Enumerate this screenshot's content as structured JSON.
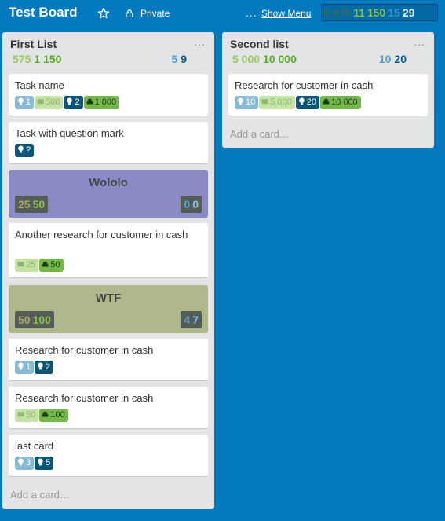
{
  "board": {
    "title": "Test Board",
    "visibility": "Private",
    "menu_dots": "...",
    "show_menu": "Show Menu",
    "stats": [
      "5",
      "575",
      "11",
      "150",
      "15",
      "29"
    ]
  },
  "lists": [
    {
      "title": "First List",
      "menu": "...",
      "stats_left": [
        "575",
        "1 150"
      ],
      "stats_right": [
        "5",
        "9"
      ],
      "add_card": "Add a card…",
      "cards": [
        {
          "title": "Task name",
          "badges": [
            {
              "icon": "lightbulb-icon",
              "value": "1",
              "style": "bd-lb"
            },
            {
              "icon": "book-icon",
              "value": "500",
              "style": "bd-lg"
            },
            {
              "icon": "lightbulb-icon",
              "value": "2",
              "style": "bd-db"
            },
            {
              "icon": "money-icon",
              "value": "1 000",
              "style": "bd-g"
            }
          ]
        },
        {
          "title": "Task with question mark",
          "badges": [
            {
              "icon": "lightbulb-icon",
              "value": "?",
              "style": "bd-db"
            }
          ]
        },
        {
          "separator": true,
          "title": "Wololo",
          "stats_left": [
            "25",
            "50"
          ],
          "stats_right": [
            "0",
            "0"
          ]
        },
        {
          "title": "Another research for customer in cash",
          "badges": [
            {
              "icon": "book-icon",
              "value": "25",
              "style": "bd-lg"
            },
            {
              "icon": "money-icon",
              "value": "50",
              "style": "bd-g"
            }
          ]
        },
        {
          "separator": true,
          "title": "WTF",
          "stats_left": [
            "50",
            "100"
          ],
          "stats_right": [
            "4",
            "7"
          ]
        },
        {
          "title": "Research for customer in cash",
          "badges": [
            {
              "icon": "lightbulb-icon",
              "value": "1",
              "style": "bd-lb"
            },
            {
              "icon": "lightbulb-icon",
              "value": "2",
              "style": "bd-db"
            }
          ]
        },
        {
          "title": "Research for customer in cash",
          "badges": [
            {
              "icon": "book-icon",
              "value": "50",
              "style": "bd-lg"
            },
            {
              "icon": "money-icon",
              "value": "100",
              "style": "bd-g"
            }
          ]
        },
        {
          "title": "last card",
          "badges": [
            {
              "icon": "lightbulb-icon",
              "value": "3",
              "style": "bd-lb"
            },
            {
              "icon": "lightbulb-icon",
              "value": "5",
              "style": "bd-db"
            }
          ]
        }
      ]
    },
    {
      "title": "Second list",
      "menu": "...",
      "stats_left": [
        "5 000",
        "10 000"
      ],
      "stats_right": [
        "10",
        "20"
      ],
      "add_card": "Add a card…",
      "cards": [
        {
          "title": "Research for customer in cash",
          "badges": [
            {
              "icon": "lightbulb-icon",
              "value": "10",
              "style": "bd-lb"
            },
            {
              "icon": "book-icon",
              "value": "5 000",
              "style": "bd-lg"
            },
            {
              "icon": "lightbulb-icon",
              "value": "20",
              "style": "bd-db"
            },
            {
              "icon": "money-icon",
              "value": "10 000",
              "style": "bd-g"
            }
          ]
        }
      ]
    }
  ]
}
